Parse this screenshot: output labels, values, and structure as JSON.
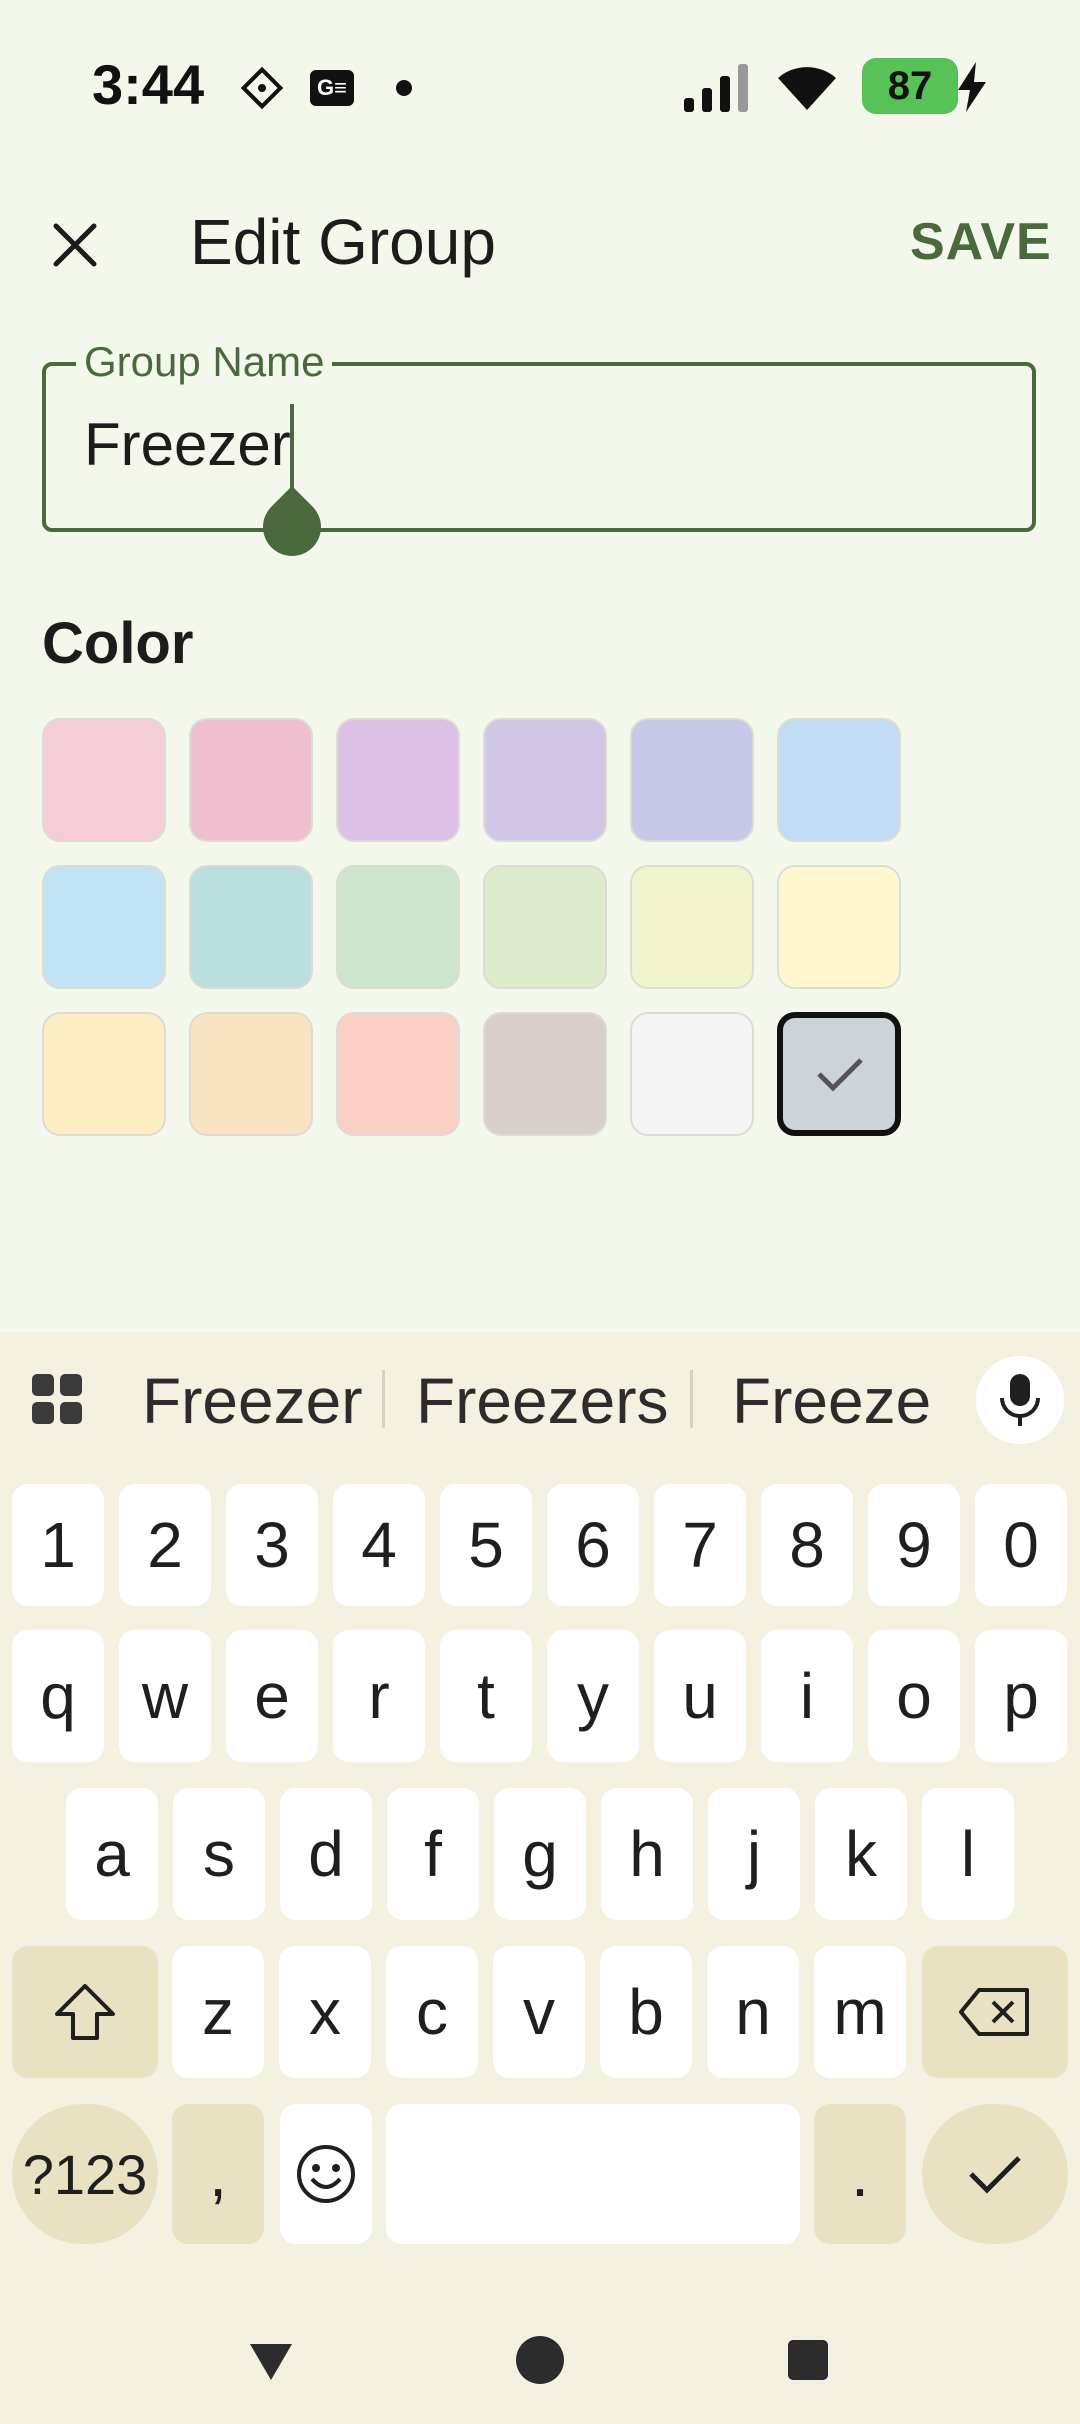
{
  "status_bar": {
    "time": "3:44",
    "battery": "87",
    "icons": [
      "diamond-grid-icon",
      "gmail-icon",
      "dot-icon",
      "signal-icon",
      "wifi-icon",
      "battery-icon",
      "charging-icon"
    ]
  },
  "header": {
    "title": "Edit Group",
    "save_label": "SAVE",
    "close_icon": "close-icon"
  },
  "field": {
    "label": "Group Name",
    "value": "Freezer"
  },
  "color_section": {
    "label": "Color"
  },
  "colors": [
    [
      "#f4cdd6",
      "#efbfd0",
      "#dcc0e6",
      "#d0c6e6",
      "#c6c8e6",
      "#c2dcf6"
    ],
    [
      "#c2e2f6",
      "#badfdc",
      "#cde4cd",
      "#deebcd",
      "#eff4cd",
      "#fef7cd"
    ],
    [
      "#fdeec2",
      "#fae3c0",
      "#fad0c6",
      "#d8cfcc",
      "#f4f4f4",
      "#cdd4d8"
    ]
  ],
  "selected_color": "#cdd4d8",
  "keyboard": {
    "suggestions": [
      "Freezer",
      "Freezers",
      "Freeze"
    ],
    "row_numbers": [
      "1",
      "2",
      "3",
      "4",
      "5",
      "6",
      "7",
      "8",
      "9",
      "0"
    ],
    "row1": [
      "q",
      "w",
      "e",
      "r",
      "t",
      "y",
      "u",
      "i",
      "o",
      "p"
    ],
    "row2": [
      "a",
      "s",
      "d",
      "f",
      "g",
      "h",
      "j",
      "k",
      "l"
    ],
    "row3": [
      "z",
      "x",
      "c",
      "v",
      "b",
      "n",
      "m"
    ],
    "symbols_label": "?123",
    "comma": ",",
    "period": "."
  },
  "accent": "#4a6a3d"
}
